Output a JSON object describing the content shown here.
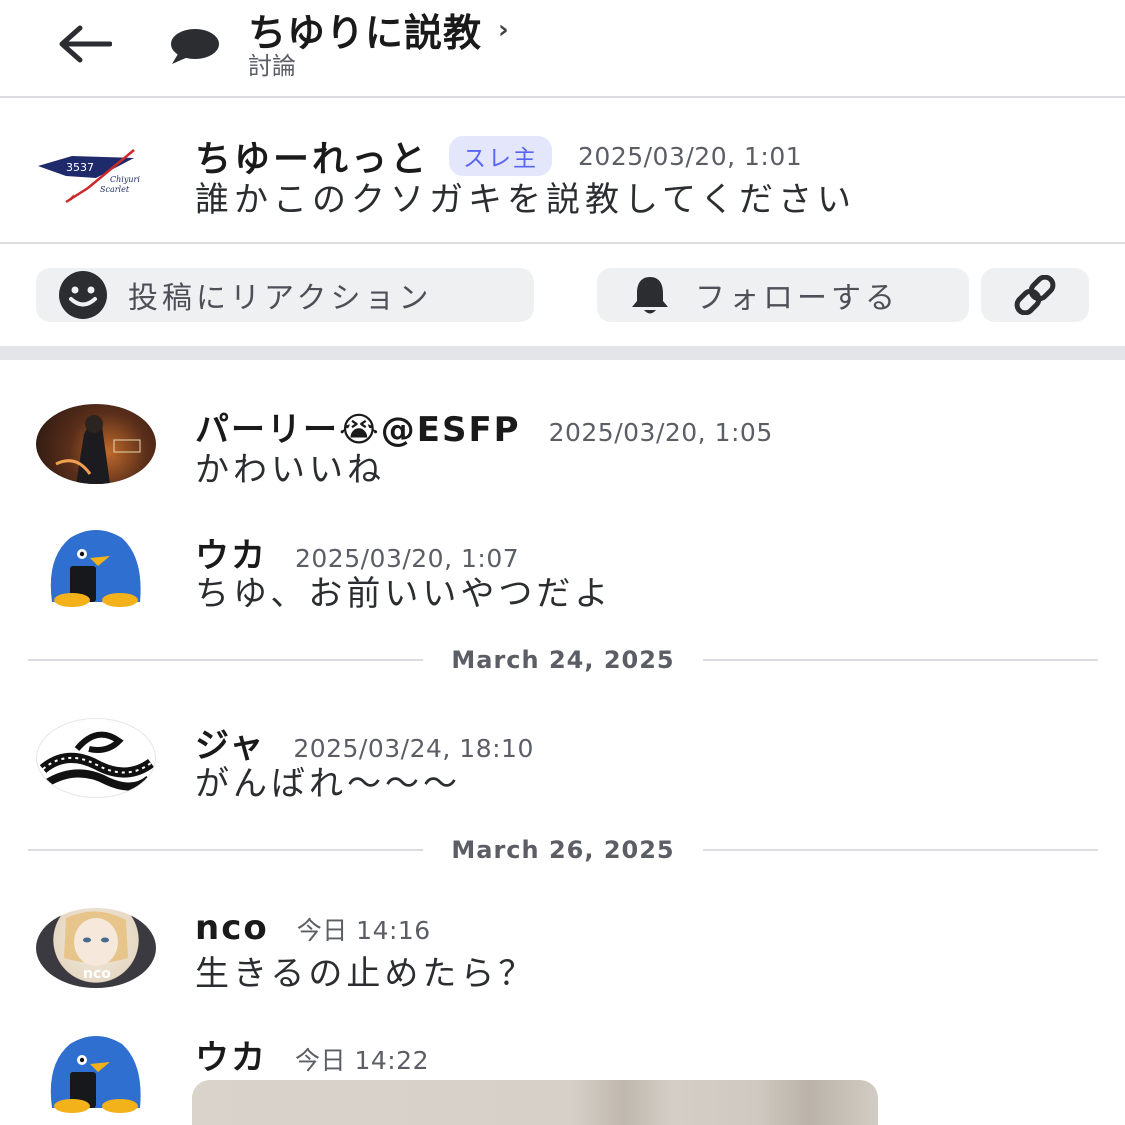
{
  "header": {
    "title": "ちゆりに説教",
    "chevron": "›",
    "subtitle": "討論",
    "back_icon": "arrow-left-icon",
    "channel_icon": "chat-bubble-icon"
  },
  "op": {
    "author": "ちゆーれっと",
    "badge": "スレ主",
    "timestamp": "2025/03/20, 1:01",
    "text": "誰かこのクソガキを説教してください",
    "logo_text": "3537",
    "logo_sub1": "Chiyuri",
    "logo_sub2": "Scarlet"
  },
  "actions": {
    "react_label": "投稿にリアクション",
    "react_icon": "smiley-icon",
    "follow_label": "フォローする",
    "follow_icon": "bell-icon",
    "link_icon": "link-icon"
  },
  "messages": [
    {
      "author": "パーリー😭@ESFP",
      "timestamp": "2025/03/20, 1:05",
      "text": "かわいいね"
    },
    {
      "author": "ウカ",
      "timestamp": "2025/03/20, 1:07",
      "text": "ちゆ、お前いいやつだよ"
    },
    {
      "author": "ジャ",
      "timestamp": "2025/03/24, 18:10",
      "text": "がんばれ〜〜〜"
    },
    {
      "author": "nco",
      "timestamp": "今日 14:16",
      "text": "生きるの止めたら？",
      "avatar_text": "nco"
    },
    {
      "author": "ウカ",
      "timestamp": "今日 14:22",
      "text": ""
    }
  ],
  "date_separators": [
    "March 24, 2025",
    "March 26, 2025"
  ],
  "colors": {
    "accent": "#5865f2",
    "badge_bg": "#e4e6fb",
    "divider": "#dcdde0",
    "button_bg": "#eef0f2"
  }
}
